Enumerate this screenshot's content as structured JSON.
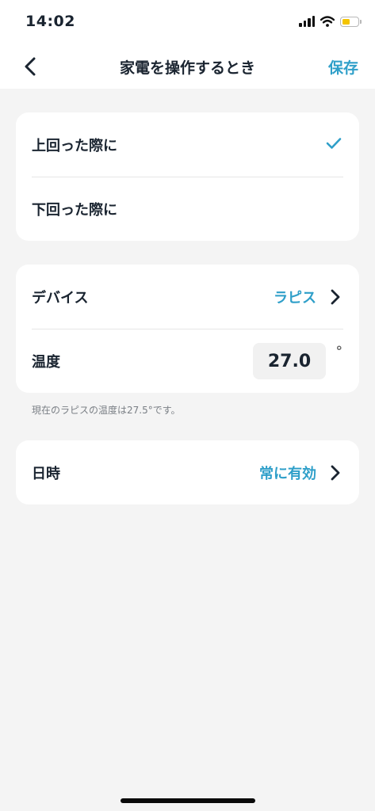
{
  "status_bar": {
    "time": "14:02",
    "battery_level": 0.58,
    "battery_color": "#f4c400"
  },
  "nav": {
    "title": "家電を操作するとき",
    "save_label": "保存"
  },
  "condition": {
    "options": [
      {
        "label": "上回った際に",
        "selected": true
      },
      {
        "label": "下回った際に",
        "selected": false
      }
    ]
  },
  "device": {
    "label": "デバイス",
    "value": "ラピス"
  },
  "temperature": {
    "label": "温度",
    "value": "27.0",
    "unit": "°"
  },
  "helper_text": "現在のラピスの温度は27.5°です。",
  "datetime": {
    "label": "日時",
    "value": "常に有効"
  },
  "colors": {
    "accent": "#2f9fc9",
    "text": "#1a2430",
    "background": "#f4f4f4"
  }
}
